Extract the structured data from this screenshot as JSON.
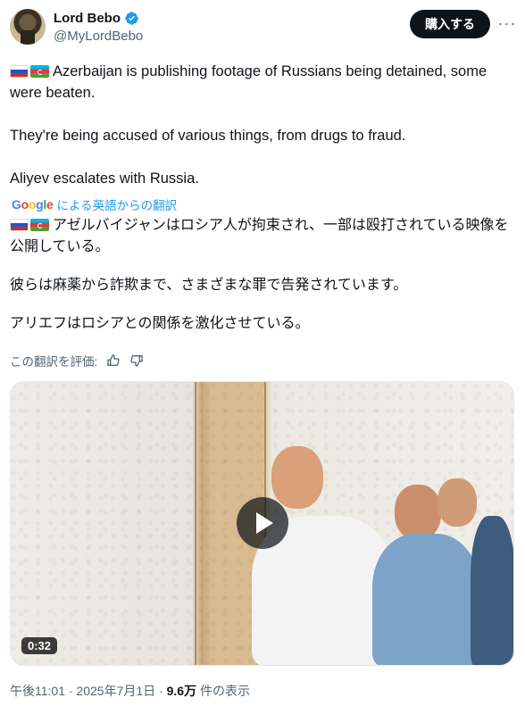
{
  "author": {
    "display_name": "Lord Bebo",
    "handle": "@MyLordBebo",
    "verified_icon": "verified-badge-icon"
  },
  "header": {
    "buy_label": "購入する",
    "more_label": "···"
  },
  "tweet": {
    "paragraphs": [
      "Azerbaijan is publishing footage of Russians being detained, some were beaten.",
      "They're being accused of various things, from drugs to fraud.",
      "Aliyev escalates with Russia."
    ],
    "flags": [
      "flag-russia",
      "flag-azerbaijan"
    ]
  },
  "translation": {
    "provider": "Google",
    "label": "による英語からの翻訳",
    "paragraphs": [
      "アゼルバイジャンはロシア人が拘束され、一部は殴打されている映像を公開している。",
      "彼らは麻薬から詐欺まで、さまざまな罪で告発されています。",
      "アリエフはロシアとの関係を激化させている。"
    ],
    "rate_label": "この翻訳を評価:"
  },
  "media": {
    "duration": "0:32",
    "play_icon": "play-icon"
  },
  "meta": {
    "time": "午後11:01 · 2025年7月1日 · ",
    "views": "9.6万",
    "views_suffix": " 件の表示"
  },
  "colors": {
    "accent": "#1d9bf0",
    "verified": "#1d9bf0",
    "text": "#0f1419",
    "muted": "#536471"
  }
}
